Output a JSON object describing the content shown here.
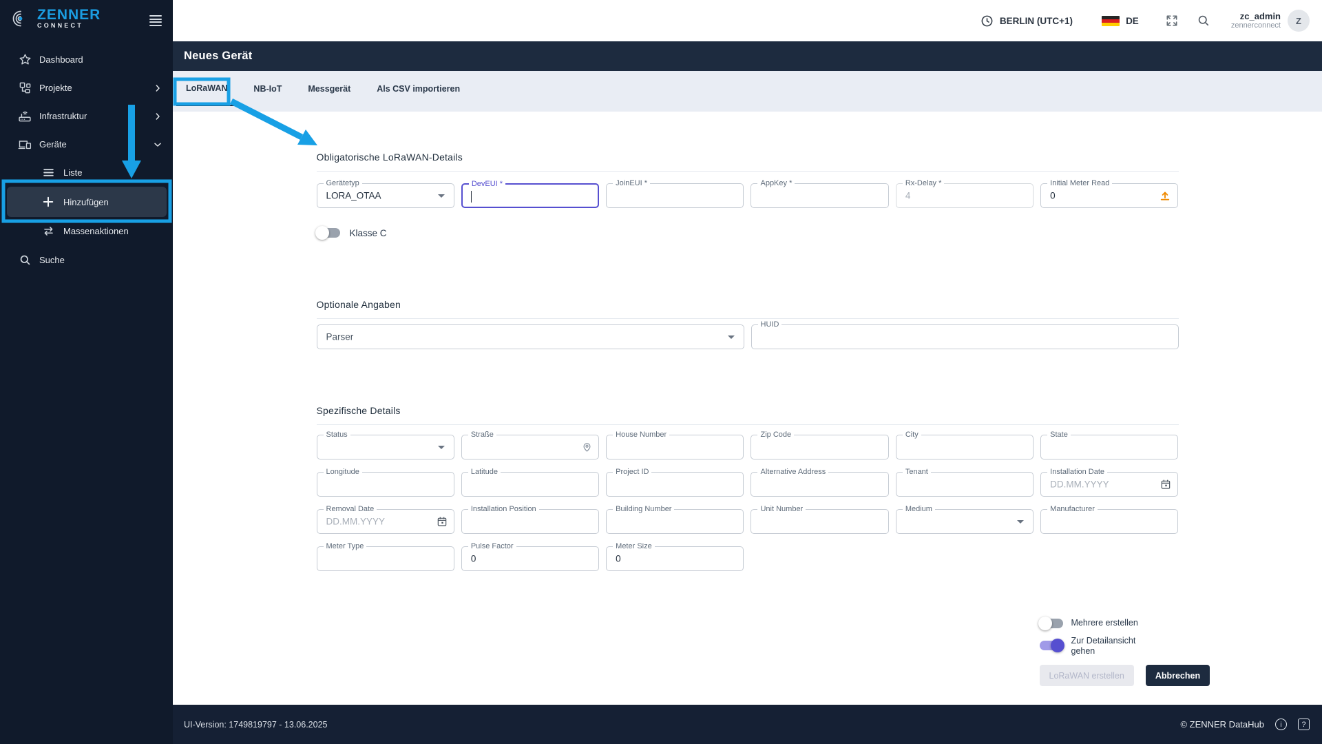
{
  "brand": {
    "name": "ZENNER",
    "sub": "CONNECT"
  },
  "topbar": {
    "timezone": "BERLIN (UTC+1)",
    "language": "DE",
    "user_name": "zc_admin",
    "user_org": "zennerconnect",
    "avatar_initial": "Z"
  },
  "sidebar": {
    "items": [
      {
        "label": "Dashboard"
      },
      {
        "label": "Projekte"
      },
      {
        "label": "Infrastruktur"
      },
      {
        "label": "Geräte"
      },
      {
        "label": "Liste"
      },
      {
        "label": "Hinzufügen"
      },
      {
        "label": "Massenaktionen"
      },
      {
        "label": "Suche"
      }
    ]
  },
  "page": {
    "title": "Neues Gerät"
  },
  "tabs": [
    {
      "label": "LoRaWAN"
    },
    {
      "label": "NB-IoT"
    },
    {
      "label": "Messgerät"
    },
    {
      "label": "Als CSV importieren"
    }
  ],
  "form": {
    "mandatory": {
      "title": "Obligatorische LoRaWAN-Details",
      "geraetetyp_label": "Gerätetyp",
      "geraetetyp_value": "LORA_OTAA",
      "deveui_label": "DevEUI *",
      "joineui_label": "JoinEUI *",
      "appkey_label": "AppKey *",
      "rxdelay_label": "Rx-Delay *",
      "rxdelay_value": "4",
      "initial_meter_read_label": "Initial Meter Read",
      "initial_meter_read_value": "0",
      "klassec_label": "Klasse C"
    },
    "optional": {
      "title": "Optionale Angaben",
      "parser_label": "Parser",
      "huid_label": "HUID"
    },
    "specific": {
      "title": "Spezifische Details",
      "status": "Status",
      "strasse": "Straße",
      "house_number": "House Number",
      "zip_code": "Zip Code",
      "city": "City",
      "state": "State",
      "longitude": "Longitude",
      "latitude": "Latitude",
      "project_id": "Project ID",
      "alternative_address": "Alternative Address",
      "tenant": "Tenant",
      "installation_date_label": "Installation Date",
      "installation_date_placeholder": "DD.MM.YYYY",
      "removal_date_label": "Removal Date",
      "removal_date_placeholder": "DD.MM.YYYY",
      "installation_position": "Installation Position",
      "building_number": "Building Number",
      "unit_number": "Unit Number",
      "medium": "Medium",
      "manufacturer": "Manufacturer",
      "meter_type": "Meter Type",
      "pulse_factor_label": "Pulse Factor",
      "pulse_factor_value": "0",
      "meter_size_label": "Meter Size",
      "meter_size_value": "0"
    }
  },
  "actions": {
    "multiple_label": "Mehrere erstellen",
    "detail_label": "Zur Detailansicht gehen",
    "submit_label": "LoRaWAN erstellen",
    "cancel_label": "Abbrechen"
  },
  "footer": {
    "version": "UI-Version: 1749819797 - 13.06.2025",
    "copyright": "© ZENNER DataHub"
  },
  "colors": {
    "annotation_blue": "#18a0e5",
    "accent_indigo": "#564fd0",
    "navy": "#1d2b3f",
    "upload_orange": "#ef8a00"
  }
}
